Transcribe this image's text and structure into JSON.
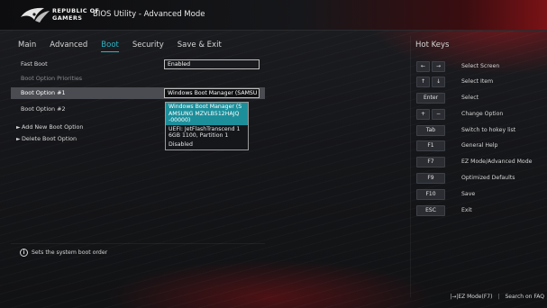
{
  "header": {
    "brand_line1": "Republic of",
    "brand_line2": "Gamers",
    "title": "BIOS Utility - Advanced Mode"
  },
  "nav": {
    "tabs": [
      {
        "label": "Main",
        "active": false
      },
      {
        "label": "Advanced",
        "active": false
      },
      {
        "label": "Boot",
        "active": true
      },
      {
        "label": "Security",
        "active": false
      },
      {
        "label": "Save & Exit",
        "active": false
      }
    ]
  },
  "boot": {
    "fast_boot_label": "Fast Boot",
    "fast_boot_value": "Enabled",
    "priorities_heading": "Boot Option Priorities",
    "option1_label": "Boot Option #1",
    "option1_value": "Windows Boot Manager (SAMSU",
    "option2_label": "Boot Option #2",
    "add_label": "Add New Boot Option",
    "delete_label": "Delete Boot Option"
  },
  "dropdown": {
    "options": [
      "Windows Boot Manager (S AMSUNG MZVLB512HAJQ -00000)",
      "UEFI: JetFlashTranscend 1 6GB 1100, Partition 1",
      "Disabled"
    ],
    "highlighted_index": 0
  },
  "hotkeys": {
    "title": "Hot Keys",
    "items": [
      {
        "keys": [
          "←",
          "→"
        ],
        "desc": "Select Screen"
      },
      {
        "keys": [
          "↑",
          "↓"
        ],
        "desc": "Select Item"
      },
      {
        "keys": [
          "Enter"
        ],
        "desc": "Select"
      },
      {
        "keys": [
          "+",
          "−"
        ],
        "desc": "Change Option"
      },
      {
        "keys": [
          "Tab"
        ],
        "desc": "Switch to hokey list"
      },
      {
        "keys": [
          "F1"
        ],
        "desc": "General Help"
      },
      {
        "keys": [
          "F7"
        ],
        "desc": "EZ Mode/Advanced Mode"
      },
      {
        "keys": [
          "F9"
        ],
        "desc": "Optimized Defaults"
      },
      {
        "keys": [
          "F10"
        ],
        "desc": "Save"
      },
      {
        "keys": [
          "ESC"
        ],
        "desc": "Exit"
      }
    ]
  },
  "help_text": "Sets the system boot order",
  "footer": {
    "ez_mode": "|→|EZ Mode(F7)",
    "separator": "|",
    "search": "Search on FAQ"
  },
  "colors": {
    "accent": "#2ab5c6",
    "highlight": "#1d8f9b",
    "brand_red": "#7a1216"
  }
}
